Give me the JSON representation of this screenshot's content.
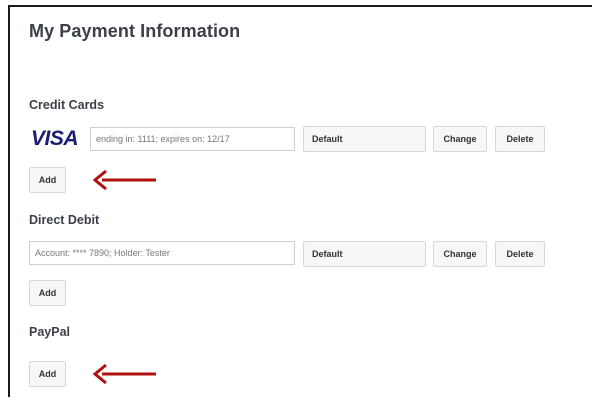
{
  "page": {
    "title": "My Payment Information"
  },
  "credit_cards": {
    "title": "Credit Cards",
    "brand": "VISA",
    "field_value": "ending in: 1111; expires on: 12/17",
    "default_label": "Default",
    "change_label": "Change",
    "delete_label": "Delete",
    "add_label": "Add"
  },
  "direct_debit": {
    "title": "Direct Debit",
    "field_value": "Account: **** 7890; Holder: Tester",
    "default_label": "Default",
    "change_label": "Change",
    "delete_label": "Delete",
    "add_label": "Add"
  },
  "paypal": {
    "title": "PayPal",
    "add_label": "Add"
  },
  "colors": {
    "arrow": "#b01010",
    "visa_blue": "#1a1f71"
  }
}
